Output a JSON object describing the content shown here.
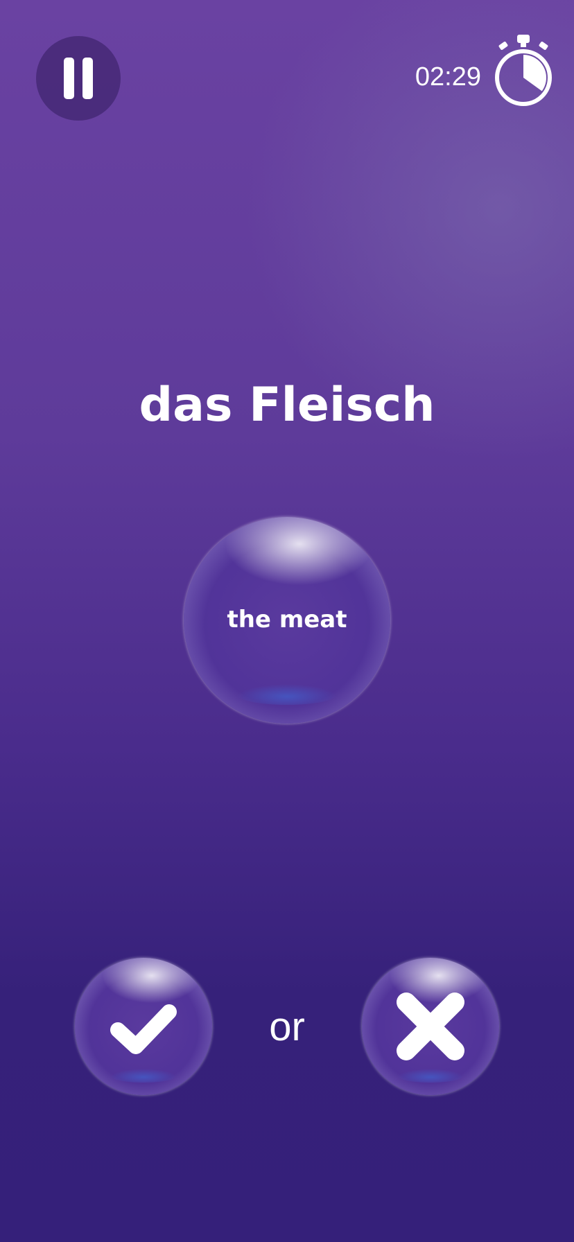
{
  "header": {
    "pause_icon": "pause-icon",
    "timer": "02:29",
    "timer_icon": "stopwatch-icon",
    "timer_elapsed_fraction": 0.35
  },
  "quiz": {
    "prompt": "das Fleisch",
    "answer": "the meat"
  },
  "choices": {
    "yes_icon": "checkmark-icon",
    "separator": "or",
    "no_icon": "cross-icon"
  },
  "colors": {
    "background_top": "#6a42a2",
    "background_bottom": "#35207a",
    "text": "#ffffff"
  }
}
